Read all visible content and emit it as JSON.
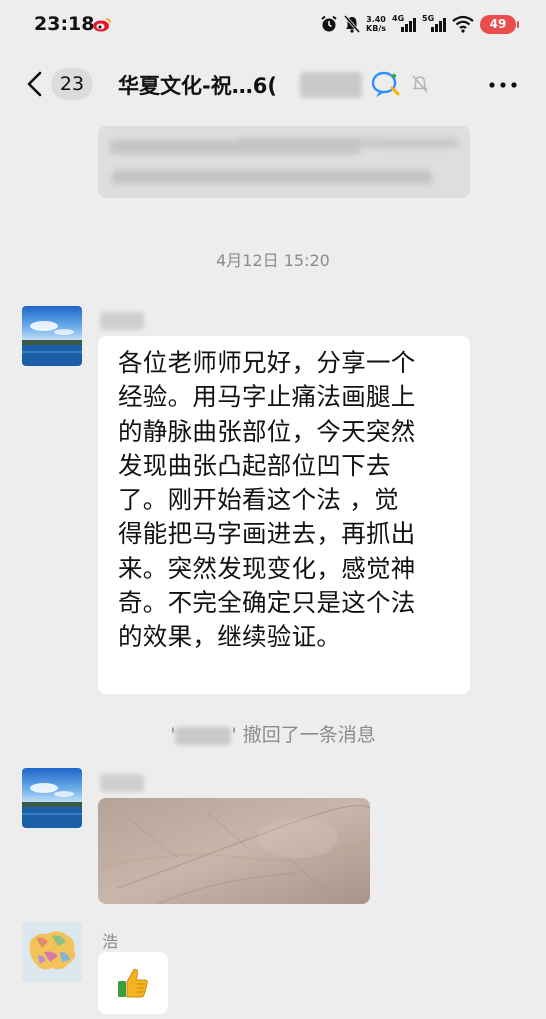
{
  "status_bar": {
    "time": "23:18",
    "speed_value": "3.40",
    "speed_unit": "KB/s",
    "net1": "4G",
    "net2": "5G",
    "battery": "49"
  },
  "header": {
    "unread_count": "23",
    "title": "华夏文化-祝…6("
  },
  "messages": {
    "timestamp": "4月12日 15:20",
    "text_lines": [
      "各位老师师兄好，分享一个",
      "经验。用马字止痛法画腿上",
      "的静脉曲张部位，今天突然",
      "发现曲张凸起部位凹下去",
      "了。刚开始看这个法 ，觉",
      "得能把马字画进去，再抓出",
      "来。突然发现变化，感觉神",
      "奇。不完全确定只是这个法",
      "的效果，继续验证。"
    ],
    "recall_quote_open": "'",
    "recall_quote_close": "'",
    "recall_text": "撤回了一条消息",
    "third_sender": "浩",
    "emoji": "👍"
  },
  "colors": {
    "background": "#ededed",
    "bubble": "#ffffff",
    "battery": "#e84c4c",
    "muted_text": "#8c8c8c"
  },
  "icons": [
    "weibo-icon",
    "alarm-icon",
    "bell-off-icon",
    "wifi-icon",
    "back-icon",
    "ai-assistant-icon",
    "mute-bell-icon",
    "more-icon",
    "thumbs-up-icon"
  ]
}
